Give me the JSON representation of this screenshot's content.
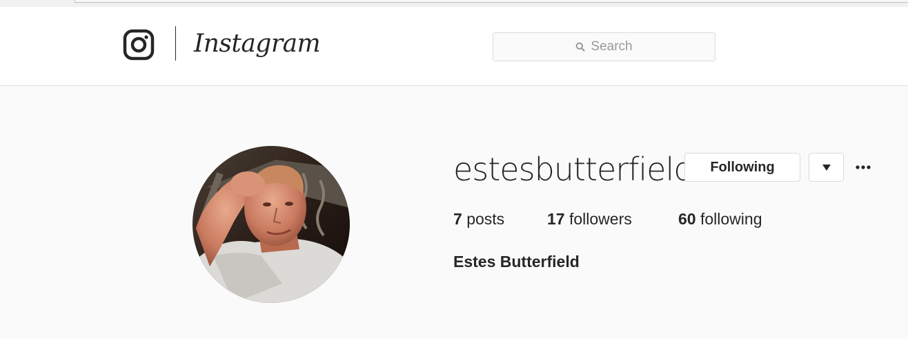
{
  "header": {
    "wordmark": "Instagram",
    "search": {
      "placeholder": "Search"
    },
    "icons": {
      "logo": "camera-icon",
      "search": "search-icon"
    }
  },
  "profile": {
    "username": "estesbutterfield",
    "follow_button_label": "Following",
    "dropdown_icon": "triangle-down-icon",
    "more_icon": "ellipsis-icon",
    "stats": {
      "posts": {
        "count": "7",
        "label": "posts"
      },
      "followers": {
        "count": "17",
        "label": "followers"
      },
      "following": {
        "count": "60",
        "label": "following"
      }
    },
    "full_name": "Estes Butterfield"
  },
  "colors": {
    "text": "#262626",
    "border": "#dbdbdb",
    "background": "#fafafa",
    "placeholder": "#999999"
  }
}
